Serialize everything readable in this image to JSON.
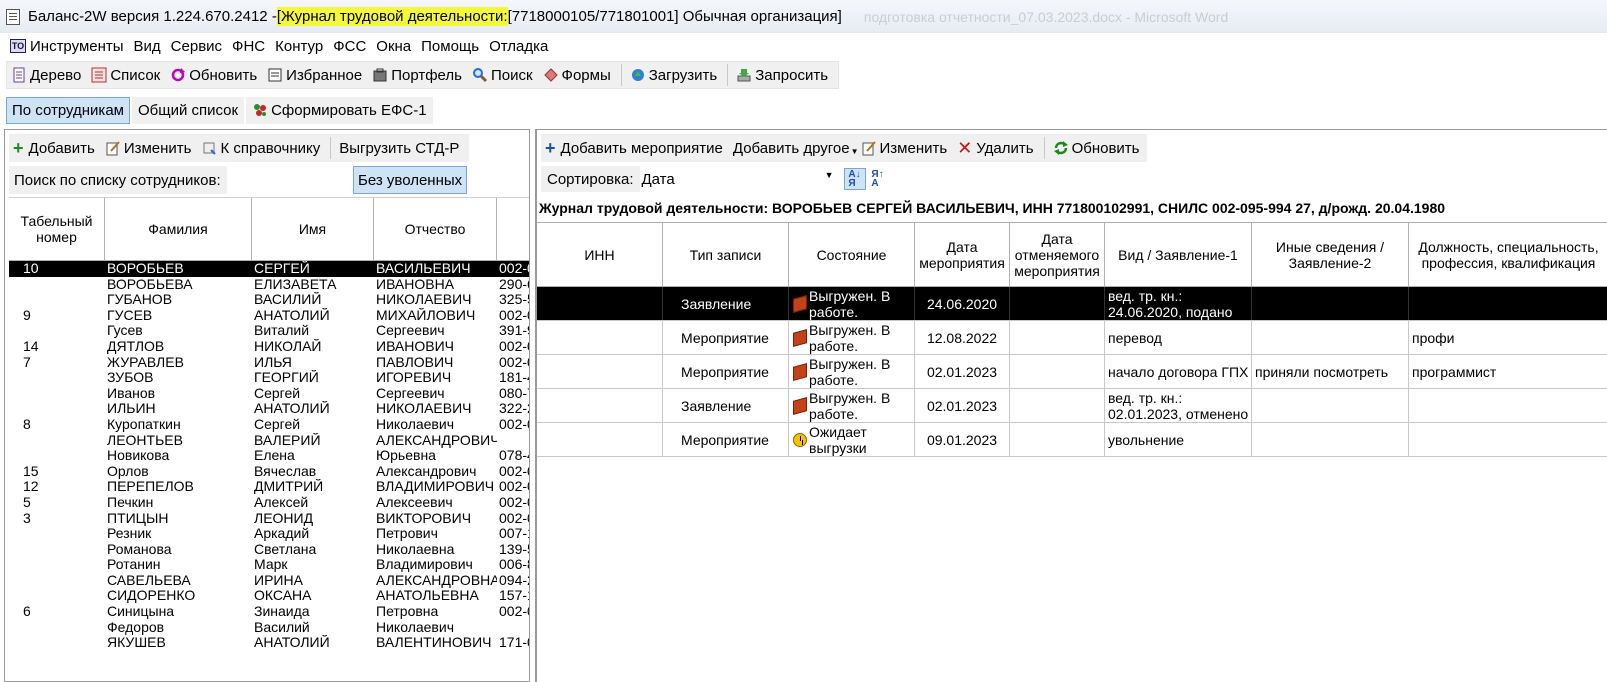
{
  "window": {
    "title_prefix": "Баланс-2W  версия 1.224.670.2412 - ",
    "title_highlight": "[Журнал трудовой деятельности:",
    "title_suffix": " [7718000105/771801001] Обычная организация]",
    "background_title": "подготовка отчетности_07.03.2023.docx - Microsoft Word"
  },
  "menu": [
    "Инструменты",
    "Вид",
    "Сервис",
    "ФНС",
    "Контур",
    "ФСС",
    "Окна",
    "Помощь",
    "Отладка"
  ],
  "toolbar": {
    "tree": "Дерево",
    "list": "Список",
    "refresh": "Обновить",
    "favorites": "Избранное",
    "portfolio": "Портфель",
    "search": "Поиск",
    "forms": "Формы",
    "upload": "Загрузить",
    "request": "Запросить"
  },
  "tabs": {
    "by_employee": "По сотрудникам",
    "common_list": "Общий список",
    "form_efs": "Сформировать ЕФС-1"
  },
  "left": {
    "add": "Добавить",
    "edit": "Изменить",
    "to_reference": "К справочнику",
    "export_std": "Выгрузить СТД-Р",
    "search_label": "Поиск по списку сотрудников:",
    "search_value": "",
    "no_fired": "Без уволенных",
    "columns": [
      "Табельный номер",
      "Фамилия",
      "Имя",
      "Отчество",
      ""
    ],
    "rows": [
      [
        "10",
        "ВОРОБЬЕВ",
        "СЕРГЕЙ",
        "ВАСИЛЬЕВИЧ",
        "002-0"
      ],
      [
        "",
        "ВОРОБЬЕВА",
        "ЕЛИЗАВЕТА",
        "ИВАНОВНА",
        "290-6"
      ],
      [
        "",
        "ГУБАНОВ",
        "ВАСИЛИЙ",
        "НИКОЛАЕВИЧ",
        "325-5"
      ],
      [
        "9",
        "ГУСЕВ",
        "АНАТОЛИЙ",
        "МИХАЙЛОВИЧ",
        "002-0"
      ],
      [
        "",
        "Гусев",
        "Виталий",
        "Сергеевич",
        "391-9"
      ],
      [
        "14",
        "ДЯТЛОВ",
        "НИКОЛАЙ",
        "ИВАНОВИЧ",
        "002-0"
      ],
      [
        "7",
        "ЖУРАВЛЕВ",
        "ИЛЬЯ",
        "ПАВЛОВИЧ",
        "002-0"
      ],
      [
        "",
        "ЗУБОВ",
        "ГЕОРГИЙ",
        "ИГОРЕВИЧ",
        "181-4"
      ],
      [
        "",
        "Иванов",
        "Сергей",
        "Сергеевич",
        "080-7"
      ],
      [
        "",
        "ИЛЬИН",
        "АНАТОЛИЙ",
        "НИКОЛАЕВИЧ",
        "322-2"
      ],
      [
        "8",
        "Куропаткин",
        "Сергей",
        "Николаевич",
        "002-0"
      ],
      [
        "",
        "ЛЕОНТЬЕВ",
        "ВАЛЕРИЙ",
        "АЛЕКСАНДРОВИЧ",
        ""
      ],
      [
        "",
        "Новикова",
        "Елена",
        "Юрьевна",
        "078-4"
      ],
      [
        "15",
        "Орлов",
        "Вячеслав",
        "Александрович",
        "002-0"
      ],
      [
        "12",
        "ПЕРЕПЕЛОВ",
        "ДМИТРИЙ",
        "ВЛАДИМИРОВИЧ",
        "002-0"
      ],
      [
        "5",
        "Печкин",
        "Алексей",
        "Алексеевич",
        "002-0"
      ],
      [
        "3",
        "ПТИЦЫН",
        "ЛЕОНИД",
        "ВИКТОРОВИЧ",
        "002-0"
      ],
      [
        "",
        "Резник",
        "Аркадий",
        "Петрович",
        "007-1"
      ],
      [
        "",
        "Романова",
        "Светлана",
        "Николаевна",
        "139-5"
      ],
      [
        "",
        "Ротанин",
        "Марк",
        "Владимирович",
        "006-8"
      ],
      [
        "",
        "САВЕЛЬЕВА",
        "ИРИНА",
        "АЛЕКСАНДРОВНА",
        "094-2"
      ],
      [
        "",
        "СИДОРЕНКО",
        "ОКСАНА",
        "АНАТОЛЬЕВНА",
        "157-1"
      ],
      [
        "6",
        "Синицына",
        "Зинаида",
        "Петровна",
        "002-0"
      ],
      [
        "",
        "Федоров",
        "Василий",
        "Николаевич",
        ""
      ],
      [
        "",
        "ЯКУШЕВ",
        "АНАТОЛИЙ",
        "ВАЛЕНТИНОВИЧ",
        "171-0"
      ]
    ]
  },
  "right": {
    "add_event": "Добавить мероприятие",
    "add_other": "Добавить другое",
    "edit": "Изменить",
    "delete": "Удалить",
    "refresh": "Обновить",
    "sort_label": "Сортировка:",
    "sort_value": "Дата",
    "journal_title": "Журнал трудовой деятельности: ВОРОБЬЕВ СЕРГЕЙ ВАСИЛЬЕВИЧ, ИНН 771800102991, СНИЛС 002-095-994 27, д/рожд. 20.04.1980",
    "columns": [
      "ИНН",
      "Тип записи",
      "Состояние",
      "Дата мероприятия",
      "Дата отменяемого мероприятия",
      "Вид / Заявление-1",
      "Иные сведения / Заявление-2",
      "Должность, специальность, профессия, квалификация"
    ],
    "rows": [
      {
        "inn": "",
        "type": "Заявление",
        "state_icon": "book-icon",
        "state": "Выгружен. В работе.",
        "date": "24.06.2020",
        "cancel_date": "",
        "kind": "вед. тр. кн.: 24.06.2020, подано",
        "other": "",
        "position": ""
      },
      {
        "inn": "",
        "type": "Мероприятие",
        "state_icon": "book-icon",
        "state": "Выгружен. В работе.",
        "date": "12.08.2022",
        "cancel_date": "",
        "kind": "перевод",
        "other": "",
        "position": "профи"
      },
      {
        "inn": "",
        "type": "Мероприятие",
        "state_icon": "book-icon",
        "state": "Выгружен. В работе.",
        "date": "02.01.2023",
        "cancel_date": "",
        "kind": "начало договора ГПХ",
        "other": "приняли посмотреть",
        "position": "программист"
      },
      {
        "inn": "",
        "type": "Заявление",
        "state_icon": "book-icon",
        "state": "Выгружен. В работе.",
        "date": "02.01.2023",
        "cancel_date": "",
        "kind": "вед. тр. кн.: 02.01.2023, отменено",
        "other": "",
        "position": ""
      },
      {
        "inn": "",
        "type": "Мероприятие",
        "state_icon": "clock-icon",
        "state": "Ожидает выгрузки",
        "date": "09.01.2023",
        "cancel_date": "",
        "kind": "увольнение",
        "other": "",
        "position": ""
      }
    ]
  }
}
